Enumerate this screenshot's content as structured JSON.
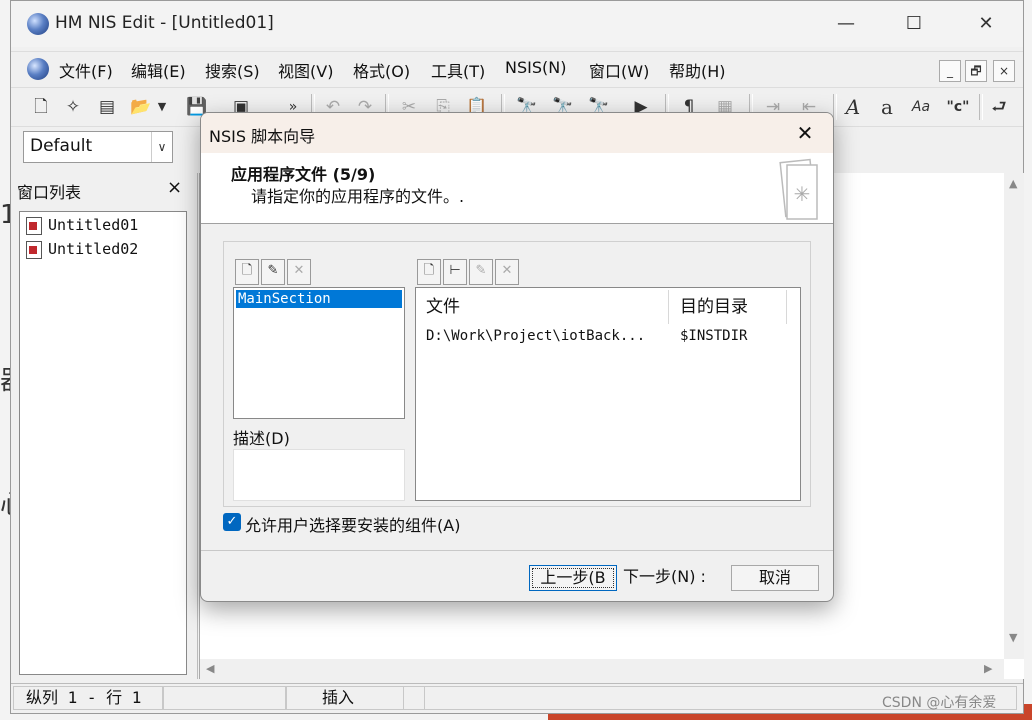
{
  "app": {
    "title": "HM NIS Edit - [Untitled01]",
    "window_controls": [
      "—",
      "☐",
      "✕"
    ]
  },
  "menu": {
    "items": [
      "文件(F)",
      "编辑(E)",
      "搜索(S)",
      "视图(V)",
      "格式(O)",
      "工具(T)",
      "NSIS(N)",
      "窗口(W)",
      "帮助(H)"
    ],
    "mdi_controls": [
      "_",
      "🗗",
      "×"
    ]
  },
  "toolbar": {
    "icons": [
      "new-file-icon",
      "wizard-icon",
      "template-icon",
      "open-icon",
      "dropdown-icon",
      "save-icon",
      "save-all-icon",
      "more-icon",
      "undo-icon",
      "redo-icon",
      "cut-icon",
      "copy-icon",
      "paste-icon",
      "find-icon",
      "find-next-icon",
      "replace-icon",
      "goto-line-icon",
      "paragraph-icon",
      "compile-icon",
      "indent-icon",
      "outdent-icon",
      "font-italic-icon",
      "font-a-icon",
      "font-aa-icon",
      "quote-c-icon",
      "wrap-icon"
    ],
    "combo_value": "Default"
  },
  "window_list": {
    "title": "窗口列表",
    "close": "×",
    "items": [
      "Untitled01",
      "Untitled02"
    ]
  },
  "status": {
    "position": "纵列 1 - 行 1",
    "mode": "插入"
  },
  "dialog": {
    "title": "NSIS 脚本向导",
    "step_title": "应用程序文件 (5/9)",
    "step_desc": "请指定你的应用程序的文件。.",
    "sections": [
      "MainSection"
    ],
    "desc_label": "描述(D)",
    "columns": [
      "文件",
      "目的目录"
    ],
    "files": [
      {
        "file": "D:\\Work\\Project\\iotBack...",
        "dest": "$INSTDIR"
      }
    ],
    "allow_label": "允许用户选择要安装的组件(A)",
    "allow_checked": true,
    "buttons": {
      "back": "上一步(B",
      "next": "下一步(N) :",
      "cancel": "取消"
    }
  },
  "watermark": "CSDN @心有余爱"
}
